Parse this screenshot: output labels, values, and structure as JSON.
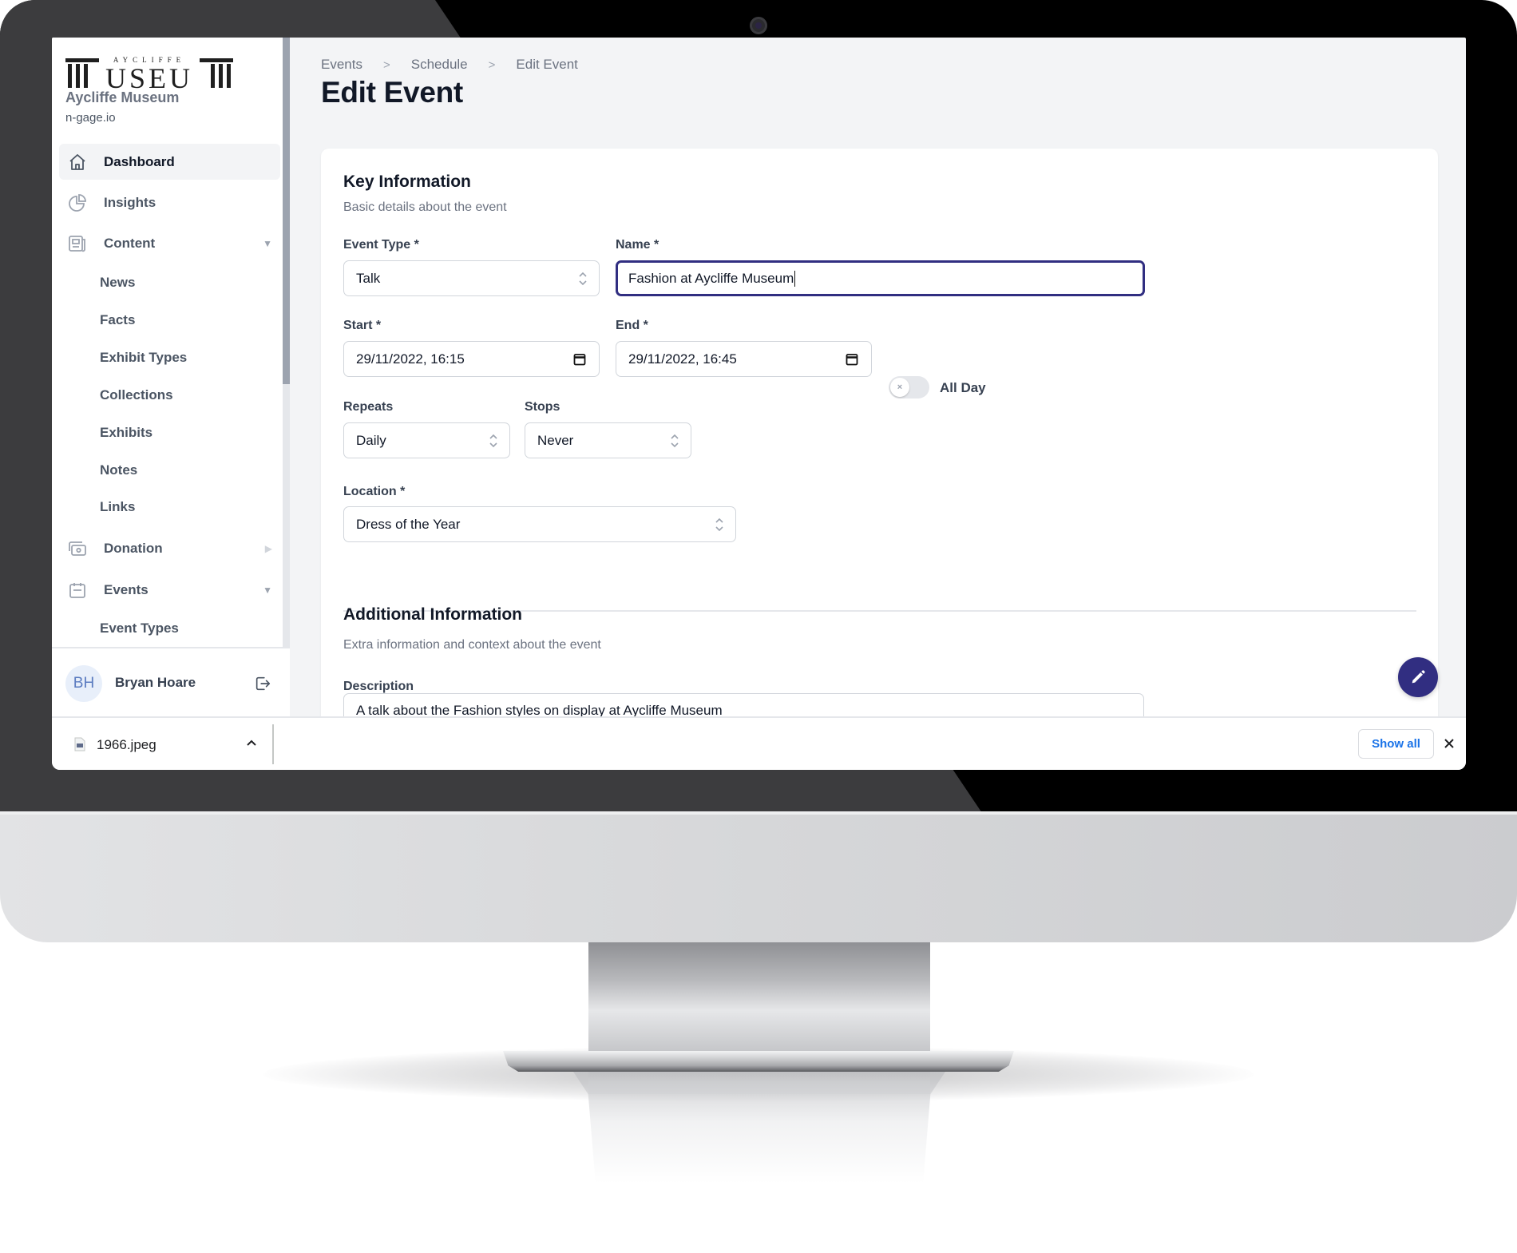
{
  "sidebar": {
    "logo_alt": "Aycliffe Museum logo",
    "logo_top_text": "AYCLIFFE",
    "logo_main_text": "USEU",
    "org_name": "Aycliffe Museum",
    "org_domain": "n-gage.io",
    "items": [
      {
        "label": "Dashboard",
        "icon": "home-icon",
        "active": true
      },
      {
        "label": "Insights",
        "icon": "pie-chart-icon"
      },
      {
        "label": "Content",
        "icon": "newspaper-icon",
        "expanded": true,
        "children": [
          "News",
          "Facts",
          "Exhibit Types",
          "Collections",
          "Exhibits",
          "Notes",
          "Links"
        ]
      },
      {
        "label": "Donation",
        "icon": "cash-icon",
        "expanded": false
      },
      {
        "label": "Events",
        "icon": "calendar-icon",
        "expanded": true,
        "children": [
          "Event Types"
        ]
      }
    ],
    "carets": {
      "down": "▼",
      "right": "▶"
    },
    "user": {
      "initials": "BH",
      "name": "Bryan Hoare"
    }
  },
  "breadcrumb": [
    "Events",
    "Schedule",
    "Edit Event"
  ],
  "breadcrumb_separator": ">",
  "page_title": "Edit Event",
  "key_info": {
    "title": "Key Information",
    "subtitle": "Basic details about the event",
    "event_type": {
      "label": "Event Type *",
      "value": "Talk"
    },
    "name": {
      "label": "Name *",
      "value": "Fashion at Aycliffe Museum"
    },
    "start": {
      "label": "Start *",
      "value": "29/11/2022, 16:15"
    },
    "end": {
      "label": "End *",
      "value": "29/11/2022, 16:45"
    },
    "all_day": {
      "label": "All Day",
      "checked": false,
      "knob_glyph": "×"
    },
    "repeats": {
      "label": "Repeats",
      "value": "Daily"
    },
    "stops": {
      "label": "Stops",
      "value": "Never"
    },
    "location": {
      "label": "Location *",
      "value": "Dress of the Year"
    }
  },
  "additional_info": {
    "title": "Additional Information",
    "subtitle": "Extra information and context about the event",
    "description": {
      "label": "Description",
      "value": "A talk about the Fashion styles on display at Aycliffe Museum"
    }
  },
  "fab": {
    "icon": "pencil-icon"
  },
  "colors": {
    "accent": "#312e81",
    "page_bg": "#f3f4f6",
    "muted_text": "#6b7280",
    "link_blue": "#1a73e8"
  },
  "download_bar": {
    "file_name": "1966.jpeg",
    "show_all_label": "Show all",
    "close_glyph": "✕"
  }
}
